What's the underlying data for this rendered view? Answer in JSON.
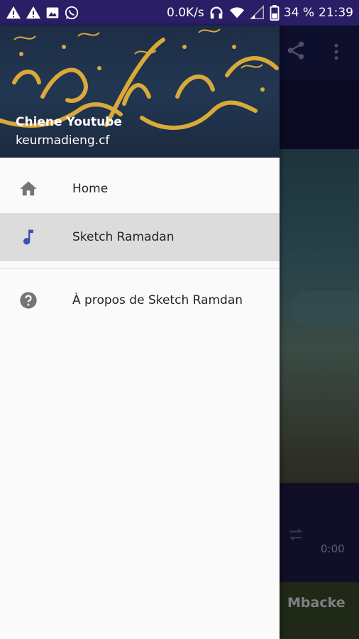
{
  "status_bar": {
    "net_speed": "0.0K/s",
    "battery": "34 %",
    "time": "21:39",
    "icons_left": [
      "warning-icon",
      "warning-icon",
      "image-icon",
      "whatsapp-icon"
    ],
    "icons_right": [
      "headphones-icon",
      "wifi-icon",
      "signal-icon",
      "battery-icon"
    ]
  },
  "drawer": {
    "header": {
      "name": "Chiene Youtube",
      "email": "keurmadieng.cf"
    },
    "items": [
      {
        "label": "Home",
        "icon": "home-icon",
        "selected": false
      },
      {
        "label": "Sketch Ramadan",
        "icon": "music-note-icon",
        "selected": true
      }
    ],
    "secondary_items": [
      {
        "label": "À propos de Sketch Ramdan",
        "icon": "help-icon"
      }
    ]
  },
  "background_app": {
    "player_time": "0:00",
    "bottom_text": "Mbacke"
  },
  "colors": {
    "status_bar": "#2a1f66",
    "accent": "#3f51b5",
    "selected_bg": "#dcdcdc"
  }
}
